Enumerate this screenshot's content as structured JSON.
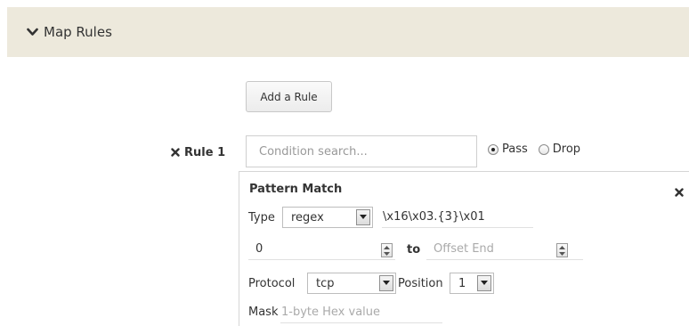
{
  "section": {
    "title": "Map Rules"
  },
  "actions": {
    "add_rule_label": "Add a Rule"
  },
  "rule": {
    "label": "Rule 1",
    "condition_placeholder": "Condition search...",
    "radio_pass_label": "Pass",
    "radio_drop_label": "Drop",
    "selected": "Pass"
  },
  "pattern_match": {
    "title": "Pattern Match",
    "type_label": "Type",
    "type_value": "regex",
    "pattern_value": "\\x16\\x03.{3}\\x01",
    "offset_start_value": "0",
    "to_label": "to",
    "offset_end_placeholder": "Offset End",
    "protocol_label": "Protocol",
    "protocol_value": "tcp",
    "position_label": "Position",
    "position_value": "1",
    "mask_label": "Mask",
    "mask_placeholder": "1-byte Hex value"
  },
  "icons": {
    "header_toggle": "chevron-down-icon",
    "rule_remove": "close-icon",
    "panel_close": "close-icon"
  },
  "colors": {
    "header_bg": "#ede9dc",
    "text": "#333333",
    "placeholder": "#999999",
    "border": "#cfcfcf"
  }
}
